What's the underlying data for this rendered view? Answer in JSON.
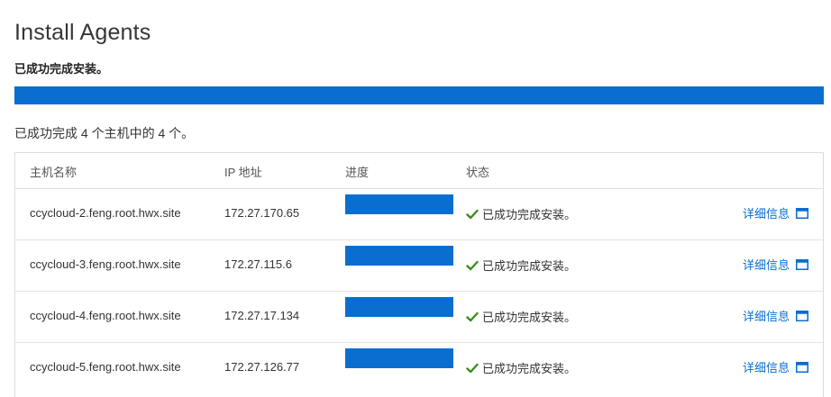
{
  "page": {
    "title": "Install Agents",
    "overall_status": "已成功完成安装。",
    "overall_progress": 1.0,
    "summary": "已成功完成 4 个主机中的 4 个。"
  },
  "table": {
    "columns": [
      "主机名称",
      "IP 地址",
      "进度",
      "状态"
    ],
    "rows": [
      {
        "host": "ccycloud-2.feng.root.hwx.site",
        "ip": "172.27.170.65",
        "progress": 1.0,
        "status": "已成功完成安装。",
        "details_label": "详细信息"
      },
      {
        "host": "ccycloud-3.feng.root.hwx.site",
        "ip": "172.27.115.6",
        "progress": 1.0,
        "status": "已成功完成安装。",
        "details_label": "详细信息"
      },
      {
        "host": "ccycloud-4.feng.root.hwx.site",
        "ip": "172.27.17.134",
        "progress": 1.0,
        "status": "已成功完成安装。",
        "details_label": "详细信息"
      },
      {
        "host": "ccycloud-5.feng.root.hwx.site",
        "ip": "172.27.126.77",
        "progress": 1.0,
        "status": "已成功完成安装。",
        "details_label": "详细信息"
      }
    ]
  },
  "colors": {
    "accent": "#0a6ed1",
    "success": "#3c8c1f",
    "track": "#e6e6e6"
  },
  "icons": {
    "status": "check-icon",
    "details": "window-icon"
  }
}
